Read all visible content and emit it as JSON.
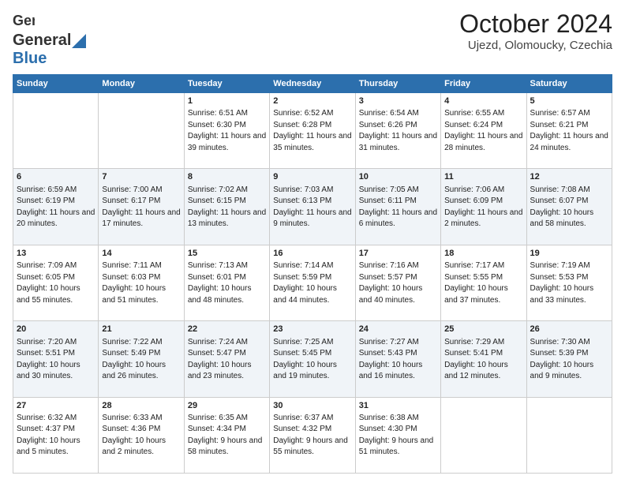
{
  "header": {
    "logo_general": "General",
    "logo_blue": "Blue",
    "month_title": "October 2024",
    "location": "Ujezd, Olomoucky, Czechia"
  },
  "weekdays": [
    "Sunday",
    "Monday",
    "Tuesday",
    "Wednesday",
    "Thursday",
    "Friday",
    "Saturday"
  ],
  "weeks": [
    [
      {
        "day": "",
        "sunrise": "",
        "sunset": "",
        "daylight": ""
      },
      {
        "day": "",
        "sunrise": "",
        "sunset": "",
        "daylight": ""
      },
      {
        "day": "1",
        "sunrise": "Sunrise: 6:51 AM",
        "sunset": "Sunset: 6:30 PM",
        "daylight": "Daylight: 11 hours and 39 minutes."
      },
      {
        "day": "2",
        "sunrise": "Sunrise: 6:52 AM",
        "sunset": "Sunset: 6:28 PM",
        "daylight": "Daylight: 11 hours and 35 minutes."
      },
      {
        "day": "3",
        "sunrise": "Sunrise: 6:54 AM",
        "sunset": "Sunset: 6:26 PM",
        "daylight": "Daylight: 11 hours and 31 minutes."
      },
      {
        "day": "4",
        "sunrise": "Sunrise: 6:55 AM",
        "sunset": "Sunset: 6:24 PM",
        "daylight": "Daylight: 11 hours and 28 minutes."
      },
      {
        "day": "5",
        "sunrise": "Sunrise: 6:57 AM",
        "sunset": "Sunset: 6:21 PM",
        "daylight": "Daylight: 11 hours and 24 minutes."
      }
    ],
    [
      {
        "day": "6",
        "sunrise": "Sunrise: 6:59 AM",
        "sunset": "Sunset: 6:19 PM",
        "daylight": "Daylight: 11 hours and 20 minutes."
      },
      {
        "day": "7",
        "sunrise": "Sunrise: 7:00 AM",
        "sunset": "Sunset: 6:17 PM",
        "daylight": "Daylight: 11 hours and 17 minutes."
      },
      {
        "day": "8",
        "sunrise": "Sunrise: 7:02 AM",
        "sunset": "Sunset: 6:15 PM",
        "daylight": "Daylight: 11 hours and 13 minutes."
      },
      {
        "day": "9",
        "sunrise": "Sunrise: 7:03 AM",
        "sunset": "Sunset: 6:13 PM",
        "daylight": "Daylight: 11 hours and 9 minutes."
      },
      {
        "day": "10",
        "sunrise": "Sunrise: 7:05 AM",
        "sunset": "Sunset: 6:11 PM",
        "daylight": "Daylight: 11 hours and 6 minutes."
      },
      {
        "day": "11",
        "sunrise": "Sunrise: 7:06 AM",
        "sunset": "Sunset: 6:09 PM",
        "daylight": "Daylight: 11 hours and 2 minutes."
      },
      {
        "day": "12",
        "sunrise": "Sunrise: 7:08 AM",
        "sunset": "Sunset: 6:07 PM",
        "daylight": "Daylight: 10 hours and 58 minutes."
      }
    ],
    [
      {
        "day": "13",
        "sunrise": "Sunrise: 7:09 AM",
        "sunset": "Sunset: 6:05 PM",
        "daylight": "Daylight: 10 hours and 55 minutes."
      },
      {
        "day": "14",
        "sunrise": "Sunrise: 7:11 AM",
        "sunset": "Sunset: 6:03 PM",
        "daylight": "Daylight: 10 hours and 51 minutes."
      },
      {
        "day": "15",
        "sunrise": "Sunrise: 7:13 AM",
        "sunset": "Sunset: 6:01 PM",
        "daylight": "Daylight: 10 hours and 48 minutes."
      },
      {
        "day": "16",
        "sunrise": "Sunrise: 7:14 AM",
        "sunset": "Sunset: 5:59 PM",
        "daylight": "Daylight: 10 hours and 44 minutes."
      },
      {
        "day": "17",
        "sunrise": "Sunrise: 7:16 AM",
        "sunset": "Sunset: 5:57 PM",
        "daylight": "Daylight: 10 hours and 40 minutes."
      },
      {
        "day": "18",
        "sunrise": "Sunrise: 7:17 AM",
        "sunset": "Sunset: 5:55 PM",
        "daylight": "Daylight: 10 hours and 37 minutes."
      },
      {
        "day": "19",
        "sunrise": "Sunrise: 7:19 AM",
        "sunset": "Sunset: 5:53 PM",
        "daylight": "Daylight: 10 hours and 33 minutes."
      }
    ],
    [
      {
        "day": "20",
        "sunrise": "Sunrise: 7:20 AM",
        "sunset": "Sunset: 5:51 PM",
        "daylight": "Daylight: 10 hours and 30 minutes."
      },
      {
        "day": "21",
        "sunrise": "Sunrise: 7:22 AM",
        "sunset": "Sunset: 5:49 PM",
        "daylight": "Daylight: 10 hours and 26 minutes."
      },
      {
        "day": "22",
        "sunrise": "Sunrise: 7:24 AM",
        "sunset": "Sunset: 5:47 PM",
        "daylight": "Daylight: 10 hours and 23 minutes."
      },
      {
        "day": "23",
        "sunrise": "Sunrise: 7:25 AM",
        "sunset": "Sunset: 5:45 PM",
        "daylight": "Daylight: 10 hours and 19 minutes."
      },
      {
        "day": "24",
        "sunrise": "Sunrise: 7:27 AM",
        "sunset": "Sunset: 5:43 PM",
        "daylight": "Daylight: 10 hours and 16 minutes."
      },
      {
        "day": "25",
        "sunrise": "Sunrise: 7:29 AM",
        "sunset": "Sunset: 5:41 PM",
        "daylight": "Daylight: 10 hours and 12 minutes."
      },
      {
        "day": "26",
        "sunrise": "Sunrise: 7:30 AM",
        "sunset": "Sunset: 5:39 PM",
        "daylight": "Daylight: 10 hours and 9 minutes."
      }
    ],
    [
      {
        "day": "27",
        "sunrise": "Sunrise: 6:32 AM",
        "sunset": "Sunset: 4:37 PM",
        "daylight": "Daylight: 10 hours and 5 minutes."
      },
      {
        "day": "28",
        "sunrise": "Sunrise: 6:33 AM",
        "sunset": "Sunset: 4:36 PM",
        "daylight": "Daylight: 10 hours and 2 minutes."
      },
      {
        "day": "29",
        "sunrise": "Sunrise: 6:35 AM",
        "sunset": "Sunset: 4:34 PM",
        "daylight": "Daylight: 9 hours and 58 minutes."
      },
      {
        "day": "30",
        "sunrise": "Sunrise: 6:37 AM",
        "sunset": "Sunset: 4:32 PM",
        "daylight": "Daylight: 9 hours and 55 minutes."
      },
      {
        "day": "31",
        "sunrise": "Sunrise: 6:38 AM",
        "sunset": "Sunset: 4:30 PM",
        "daylight": "Daylight: 9 hours and 51 minutes."
      },
      {
        "day": "",
        "sunrise": "",
        "sunset": "",
        "daylight": ""
      },
      {
        "day": "",
        "sunrise": "",
        "sunset": "",
        "daylight": ""
      }
    ]
  ]
}
